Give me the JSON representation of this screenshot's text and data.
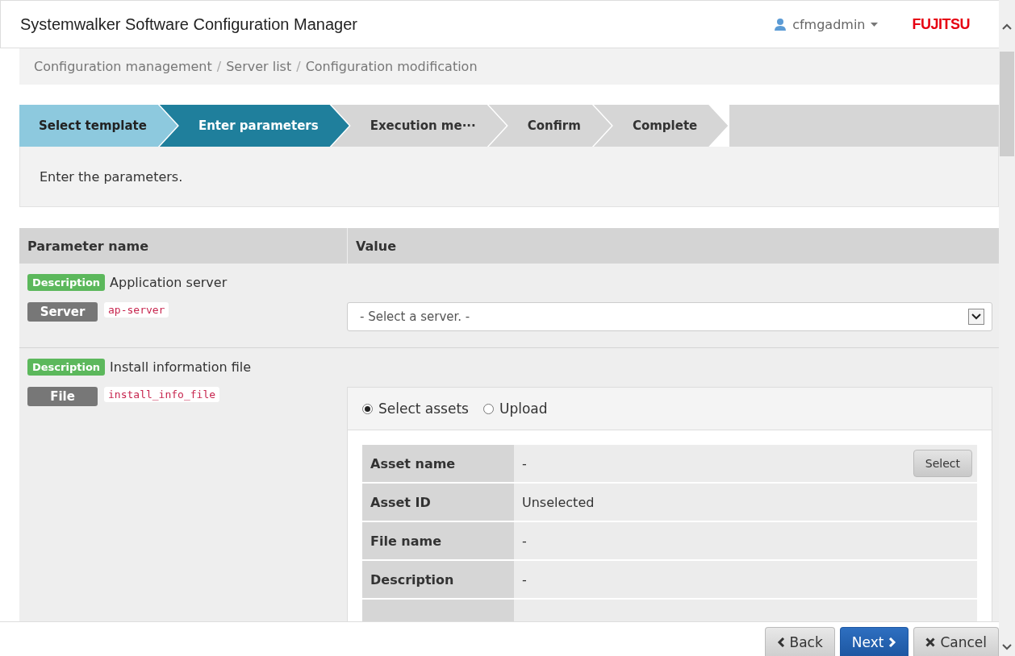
{
  "header": {
    "title": "Systemwalker Software Configuration Manager",
    "user": "cfmgadmin",
    "logo": "FUJITSU"
  },
  "breadcrumb": [
    {
      "label": "Configuration management"
    },
    {
      "separator": "/",
      "label": "Server list"
    },
    {
      "separator": "/",
      "label": "Configuration modification"
    }
  ],
  "steps": [
    {
      "label": "Select template",
      "completed": true,
      "selected": false
    },
    {
      "label": "Enter parameters",
      "completed": false,
      "selected": true
    },
    {
      "label": "Execution me···",
      "completed": false,
      "selected": false
    },
    {
      "label": "Confirm",
      "completed": false,
      "selected": false
    },
    {
      "label": "Complete",
      "completed": false,
      "selected": false
    }
  ],
  "instruction": "Enter the parameters.",
  "table": {
    "columns": [
      "Parameter name",
      "Value"
    ],
    "rows": [
      {
        "description_tag": "Description",
        "description": "Application server",
        "type_tag": "Server",
        "param": "ap-server",
        "kind": "select",
        "placeholder": "- Select a server. -"
      },
      {
        "description_tag": "Description",
        "description": "Install information file",
        "type_tag": "File",
        "param": "install_info_file",
        "kind": "file",
        "options": [
          {
            "label": "Select assets",
            "selected": true
          },
          {
            "label": "Upload",
            "selected": false
          }
        ],
        "asset_rows": [
          {
            "label": "Asset name",
            "value": "-",
            "button": "Select"
          },
          {
            "label": "Asset ID",
            "value": "Unselected"
          },
          {
            "label": "File name",
            "value": "-"
          },
          {
            "label": "Description",
            "value": "-"
          }
        ]
      }
    ]
  },
  "footer": {
    "buttons": [
      {
        "label": "Back",
        "kind": "back"
      },
      {
        "label": "Next",
        "kind": "next"
      },
      {
        "label": "Cancel",
        "kind": "cancel"
      }
    ]
  }
}
